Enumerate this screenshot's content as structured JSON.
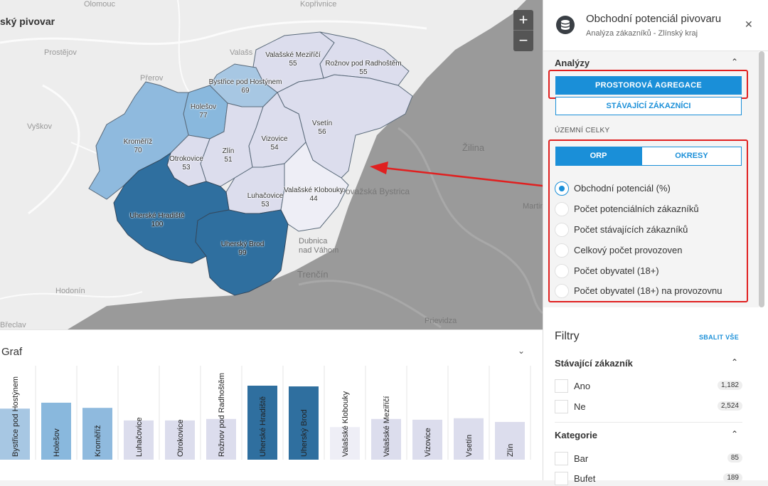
{
  "app": {
    "title": "ský pivovar"
  },
  "map": {
    "zoom_in": "+",
    "zoom_out": "−",
    "background_cities": [
      "Olomouc",
      "Kopřivnice",
      "Prostějov",
      "Přerov",
      "Vyškov",
      "Valašs",
      "Žilina",
      "Považská Bystrica",
      "Martin",
      "Dubnica nad Váhom",
      "Trenčín",
      "Hodonín",
      "Prievidza",
      "Břeclav"
    ],
    "regions": [
      {
        "name": "Valašské Meziříčí",
        "value": "55",
        "color": "#dcdded"
      },
      {
        "name": "Rožnov pod Radhoštěm",
        "value": "55",
        "color": "#dcdded"
      },
      {
        "name": "Bystřice pod Hostýnem",
        "value": "69",
        "color": "#a7c7e3"
      },
      {
        "name": "Holešov",
        "value": "77",
        "color": "#89b8dd"
      },
      {
        "name": "Vsetín",
        "value": "56",
        "color": "#dcdded"
      },
      {
        "name": "Kroměříž",
        "value": "70",
        "color": "#8fbade"
      },
      {
        "name": "Vizovice",
        "value": "54",
        "color": "#dcdded"
      },
      {
        "name": "Otrokovice",
        "value": "53",
        "color": "#dcdded"
      },
      {
        "name": "Zlín",
        "value": "51",
        "color": "#dcdded"
      },
      {
        "name": "Valašské Klobouky",
        "value": "44",
        "color": "#eeeef6"
      },
      {
        "name": "Luhačovice",
        "value": "53",
        "color": "#dcdded"
      },
      {
        "name": "Uherské Hradiště",
        "value": "100",
        "color": "#2f6f9f"
      },
      {
        "name": "Uherský Brod",
        "value": "99",
        "color": "#2f6f9f"
      }
    ]
  },
  "graph": {
    "title": "Graf",
    "toggle_icon": "chevron-down-icon"
  },
  "chart_data": {
    "type": "bar",
    "categories": [
      "Bystřice pod Hostýnem",
      "Holešov",
      "Kroměříž",
      "Luhačovice",
      "Otrokovice",
      "Rožnov pod Radhoštěm",
      "Uherské Hradiště",
      "Uherský Brod",
      "Valašské Klobouky",
      "Valašské Meziříčí",
      "Vizovice",
      "Vsetín",
      "Zlín"
    ],
    "values": [
      69,
      77,
      70,
      53,
      53,
      55,
      100,
      99,
      44,
      55,
      54,
      56,
      51
    ],
    "colors": [
      "#a7c7e3",
      "#89b8dd",
      "#8fbade",
      "#dcdded",
      "#dcdded",
      "#dcdded",
      "#2f6f9f",
      "#2f6f9f",
      "#eeeef6",
      "#dcdded",
      "#dcdded",
      "#dcdded",
      "#dcdded"
    ],
    "xlabel": "",
    "ylabel": "",
    "ylim": [
      0,
      100
    ],
    "grid": true
  },
  "panel": {
    "title": "Obchodní potenciál pivovaru",
    "subtitle": "Analýza zákazníků - Zlínský kraj",
    "close_icon": "close-icon",
    "analyzy": {
      "title": "Analýzy",
      "btn_agregace": "PROSTOROVÁ AGREGACE",
      "btn_zakaznici": "STÁVAJÍCÍ ZÁKAZNÍCI",
      "uzemni_celky": "ÚZEMNÍ CELKY",
      "seg_orp": "ORP",
      "seg_okresy": "OKRESY",
      "metrics": [
        {
          "label": "Obchodní potenciál (%)",
          "selected": true
        },
        {
          "label": "Počet potenciálních zákazníků",
          "selected": false
        },
        {
          "label": "Počet stávajících zákazníků",
          "selected": false
        },
        {
          "label": "Celkový počet provozoven",
          "selected": false
        },
        {
          "label": "Počet obyvatel (18+)",
          "selected": false
        },
        {
          "label": "Počet obyvatel (18+) na provozovnu",
          "selected": false
        }
      ]
    },
    "filtry": {
      "title": "Filtry",
      "collapse_all": "SBALIT VŠE",
      "stavajici": {
        "title": "Stávající zákazník",
        "items": [
          {
            "label": "Ano",
            "count": "1,182"
          },
          {
            "label": "Ne",
            "count": "2,524"
          }
        ]
      },
      "kategorie": {
        "title": "Kategorie",
        "items": [
          {
            "label": "Bar",
            "count": "85"
          },
          {
            "label": "Bufet",
            "count": "189"
          }
        ]
      }
    }
  }
}
